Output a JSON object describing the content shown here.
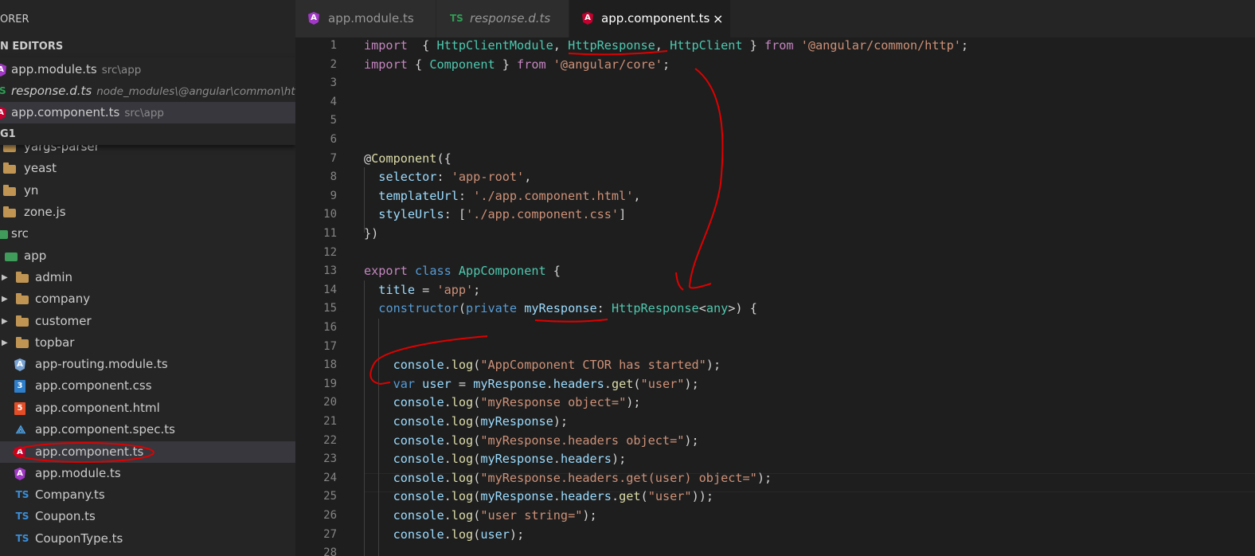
{
  "sidebar": {
    "header": "ORER",
    "open_editors": {
      "title": "N EDITORS",
      "items": [
        {
          "label": "app.module.ts",
          "desc": "src\\app",
          "icon": "angular-icon"
        },
        {
          "label": "response.d.ts",
          "desc": "node_modules\\@angular\\common\\http...",
          "icon": "ts-icon"
        },
        {
          "label": "app.component.ts",
          "desc": "src\\app",
          "icon": "angular-icon"
        }
      ],
      "ts_glyph": "S"
    },
    "project_title": "G1",
    "tree": [
      {
        "label": "yargs-parser",
        "icon": "folder-icon"
      },
      {
        "label": "yeast",
        "icon": "folder-icon"
      },
      {
        "label": "yn",
        "icon": "folder-icon"
      },
      {
        "label": "zone.js",
        "icon": "folder-icon"
      },
      {
        "label": "src",
        "icon": "src-folder-icon"
      },
      {
        "label": "app",
        "icon": "app-folder-icon"
      },
      {
        "label": "admin",
        "icon": "folder-icon"
      },
      {
        "label": "company",
        "icon": "folder-icon"
      },
      {
        "label": "customer",
        "icon": "folder-icon"
      },
      {
        "label": "topbar",
        "icon": "folder-icon"
      },
      {
        "label": "app-routing.module.ts",
        "icon": "angular-icon"
      },
      {
        "label": "app.component.css",
        "icon": "css-icon"
      },
      {
        "label": "app.component.html",
        "icon": "html-icon"
      },
      {
        "label": "app.component.spec.ts",
        "icon": "spec-icon"
      },
      {
        "label": "app.component.ts",
        "icon": "angular-icon"
      },
      {
        "label": "app.module.ts",
        "icon": "angular-icon"
      },
      {
        "label": "Company.ts",
        "icon": "ts-icon"
      },
      {
        "label": "Coupon.ts",
        "icon": "ts-icon"
      },
      {
        "label": "CouponType.ts",
        "icon": "ts-icon"
      }
    ],
    "icon_glyphs": {
      "ts": "TS",
      "css": "3",
      "html": "5",
      "angular": "A"
    }
  },
  "tabs": [
    {
      "label": "app.module.ts",
      "icon": "angular-icon"
    },
    {
      "label": "response.d.ts",
      "icon": "ts-icon",
      "glyph": "TS"
    },
    {
      "label": "app.component.ts",
      "icon": "angular-icon",
      "close": "×"
    }
  ],
  "editor": {
    "lines": [
      {
        "n": "1",
        "parts": [
          [
            "kw",
            "import"
          ],
          [
            "",
            "  { "
          ],
          [
            "ty",
            "HttpClientModule"
          ],
          [
            "",
            ", "
          ],
          [
            "ty",
            "HttpResponse"
          ],
          [
            "",
            ", "
          ],
          [
            "ty",
            "HttpClient"
          ],
          [
            "",
            " } "
          ],
          [
            "kw",
            "from"
          ],
          [
            "",
            " "
          ],
          [
            "st",
            "'@angular/common/http'"
          ],
          [
            "",
            ";"
          ]
        ]
      },
      {
        "n": "2",
        "parts": [
          [
            "kw",
            "import"
          ],
          [
            "",
            " { "
          ],
          [
            "ty",
            "Component"
          ],
          [
            "",
            " } "
          ],
          [
            "kw",
            "from"
          ],
          [
            "",
            " "
          ],
          [
            "st",
            "'@angular/core'"
          ],
          [
            "",
            ";"
          ]
        ]
      },
      {
        "n": "3",
        "parts": []
      },
      {
        "n": "4",
        "parts": []
      },
      {
        "n": "5",
        "parts": []
      },
      {
        "n": "6",
        "parts": []
      },
      {
        "n": "7",
        "parts": [
          [
            "",
            "@"
          ],
          [
            "fn",
            "Component"
          ],
          [
            "",
            "({"
          ]
        ]
      },
      {
        "n": "8",
        "parts": [
          [
            "",
            "  "
          ],
          [
            "vr",
            "selector"
          ],
          [
            "",
            ": "
          ],
          [
            "st",
            "'app-root'"
          ],
          [
            "",
            ","
          ]
        ]
      },
      {
        "n": "9",
        "parts": [
          [
            "",
            "  "
          ],
          [
            "vr",
            "templateUrl"
          ],
          [
            "",
            ": "
          ],
          [
            "st",
            "'./app.component.html'"
          ],
          [
            "",
            ","
          ]
        ]
      },
      {
        "n": "10",
        "parts": [
          [
            "",
            "  "
          ],
          [
            "vr",
            "styleUrls"
          ],
          [
            "",
            ": ["
          ],
          [
            "st",
            "'./app.component.css'"
          ],
          [
            "",
            "]"
          ]
        ]
      },
      {
        "n": "11",
        "parts": [
          [
            "",
            "})"
          ]
        ]
      },
      {
        "n": "12",
        "parts": []
      },
      {
        "n": "13",
        "parts": [
          [
            "kw",
            "export"
          ],
          [
            "",
            " "
          ],
          [
            "kb",
            "class"
          ],
          [
            "",
            " "
          ],
          [
            "ty",
            "AppComponent"
          ],
          [
            "",
            " {"
          ]
        ]
      },
      {
        "n": "14",
        "parts": [
          [
            "",
            "  "
          ],
          [
            "vr",
            "title"
          ],
          [
            "",
            " = "
          ],
          [
            "st",
            "'app'"
          ],
          [
            "",
            ";"
          ]
        ]
      },
      {
        "n": "15",
        "parts": [
          [
            "",
            "  "
          ],
          [
            "kb",
            "constructor"
          ],
          [
            "",
            "("
          ],
          [
            "kb",
            "private"
          ],
          [
            "",
            " "
          ],
          [
            "vr",
            "myResponse"
          ],
          [
            "",
            ": "
          ],
          [
            "ty",
            "HttpResponse"
          ],
          [
            "",
            "<"
          ],
          [
            "ty",
            "any"
          ],
          [
            "",
            ">) {"
          ]
        ]
      },
      {
        "n": "16",
        "parts": []
      },
      {
        "n": "17",
        "parts": []
      },
      {
        "n": "18",
        "parts": [
          [
            "",
            "    "
          ],
          [
            "vr",
            "console"
          ],
          [
            "",
            "."
          ],
          [
            "fn",
            "log"
          ],
          [
            "",
            "("
          ],
          [
            "st",
            "\"AppComponent CTOR has started\""
          ],
          [
            "",
            ");"
          ]
        ]
      },
      {
        "n": "19",
        "parts": [
          [
            "",
            "    "
          ],
          [
            "kb",
            "var"
          ],
          [
            "",
            " "
          ],
          [
            "vr",
            "user"
          ],
          [
            "",
            " = "
          ],
          [
            "vr",
            "myResponse"
          ],
          [
            "",
            "."
          ],
          [
            "vr",
            "headers"
          ],
          [
            "",
            "."
          ],
          [
            "fn",
            "get"
          ],
          [
            "",
            "("
          ],
          [
            "st",
            "\"user\""
          ],
          [
            "",
            ");"
          ]
        ]
      },
      {
        "n": "20",
        "parts": [
          [
            "",
            "    "
          ],
          [
            "vr",
            "console"
          ],
          [
            "",
            "."
          ],
          [
            "fn",
            "log"
          ],
          [
            "",
            "("
          ],
          [
            "st",
            "\"myResponse object=\""
          ],
          [
            "",
            ");"
          ]
        ]
      },
      {
        "n": "21",
        "parts": [
          [
            "",
            "    "
          ],
          [
            "vr",
            "console"
          ],
          [
            "",
            "."
          ],
          [
            "fn",
            "log"
          ],
          [
            "",
            "("
          ],
          [
            "vr",
            "myResponse"
          ],
          [
            "",
            ");"
          ]
        ]
      },
      {
        "n": "22",
        "parts": [
          [
            "",
            "    "
          ],
          [
            "vr",
            "console"
          ],
          [
            "",
            "."
          ],
          [
            "fn",
            "log"
          ],
          [
            "",
            "("
          ],
          [
            "st",
            "\"myResponse.headers object=\""
          ],
          [
            "",
            ");"
          ]
        ]
      },
      {
        "n": "23",
        "parts": [
          [
            "",
            "    "
          ],
          [
            "vr",
            "console"
          ],
          [
            "",
            "."
          ],
          [
            "fn",
            "log"
          ],
          [
            "",
            "("
          ],
          [
            "vr",
            "myResponse"
          ],
          [
            "",
            "."
          ],
          [
            "vr",
            "headers"
          ],
          [
            "",
            ");"
          ]
        ]
      },
      {
        "n": "24",
        "parts": [
          [
            "",
            "    "
          ],
          [
            "vr",
            "console"
          ],
          [
            "",
            "."
          ],
          [
            "fn",
            "log"
          ],
          [
            "",
            "("
          ],
          [
            "st",
            "\"myResponse.headers.get(user) object=\""
          ],
          [
            "",
            ");"
          ]
        ]
      },
      {
        "n": "25",
        "parts": [
          [
            "",
            "    "
          ],
          [
            "vr",
            "console"
          ],
          [
            "",
            "."
          ],
          [
            "fn",
            "log"
          ],
          [
            "",
            "("
          ],
          [
            "vr",
            "myResponse"
          ],
          [
            "",
            "."
          ],
          [
            "vr",
            "headers"
          ],
          [
            "",
            "."
          ],
          [
            "fn",
            "get"
          ],
          [
            "",
            "("
          ],
          [
            "st",
            "\"user\""
          ],
          [
            "",
            "));"
          ]
        ]
      },
      {
        "n": "26",
        "parts": [
          [
            "",
            "    "
          ],
          [
            "vr",
            "console"
          ],
          [
            "",
            "."
          ],
          [
            "fn",
            "log"
          ],
          [
            "",
            "("
          ],
          [
            "st",
            "\"user string=\""
          ],
          [
            "",
            ");"
          ]
        ]
      },
      {
        "n": "27",
        "parts": [
          [
            "",
            "    "
          ],
          [
            "vr",
            "console"
          ],
          [
            "",
            "."
          ],
          [
            "fn",
            "log"
          ],
          [
            "",
            "("
          ],
          [
            "vr",
            "user"
          ],
          [
            "",
            ");"
          ]
        ]
      },
      {
        "n": "28",
        "parts": []
      }
    ]
  },
  "colors": {
    "annotation": "#e00000",
    "accent": "#007acc"
  }
}
